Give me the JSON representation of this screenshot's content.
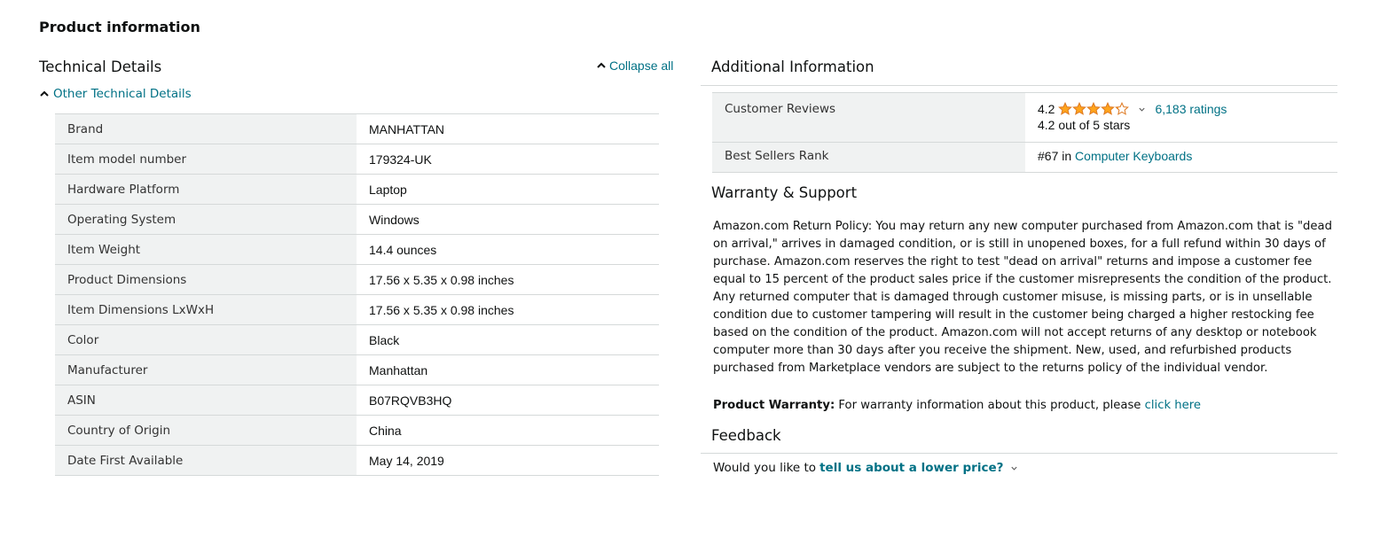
{
  "page_title": "Product information",
  "technical": {
    "heading": "Technical Details",
    "collapse_all": "Collapse all",
    "other_details": "Other Technical Details",
    "rows": [
      {
        "label": "Brand",
        "value": "MANHATTAN"
      },
      {
        "label": "Item model number",
        "value": "179324-UK"
      },
      {
        "label": "Hardware Platform",
        "value": "Laptop"
      },
      {
        "label": "Operating System",
        "value": "Windows"
      },
      {
        "label": "Item Weight",
        "value": "14.4 ounces"
      },
      {
        "label": "Product Dimensions",
        "value": "17.56 x 5.35 x 0.98 inches"
      },
      {
        "label": "Item Dimensions LxWxH",
        "value": "17.56 x 5.35 x 0.98 inches"
      },
      {
        "label": "Color",
        "value": "Black"
      },
      {
        "label": "Manufacturer",
        "value": "Manhattan"
      },
      {
        "label": "ASIN",
        "value": "B07RQVB3HQ"
      },
      {
        "label": "Country of Origin",
        "value": "China"
      },
      {
        "label": "Date First Available",
        "value": "May 14, 2019"
      }
    ]
  },
  "additional": {
    "heading": "Additional Information",
    "reviews_label": "Customer Reviews",
    "rating_value": "4.2",
    "rating_fraction": 0.84,
    "ratings_count": "6,183 ratings",
    "rating_text": "4.2 out of 5 stars",
    "rank_label": "Best Sellers Rank",
    "rank_value": "#67 in",
    "rank_category": "Computer Keyboards"
  },
  "warranty": {
    "heading": "Warranty & Support",
    "body": "Amazon.com Return Policy: You may return any new computer purchased from Amazon.com that is \"dead on arrival,\" arrives in damaged condition, or is still in unopened boxes, for a full refund within 30 days of purchase. Amazon.com reserves the right to test \"dead on arrival\" returns and impose a customer fee equal to 15 percent of the product sales price if the customer misrepresents the condition of the product. Any returned computer that is damaged through customer misuse, is missing parts, or is in unsellable condition due to customer tampering will result in the customer being charged a higher restocking fee based on the condition of the product. Amazon.com will not accept returns of any desktop or notebook computer more than 30 days after you receive the shipment. New, used, and refurbished products purchased from Marketplace vendors are subject to the returns policy of the individual vendor.",
    "product_warranty_label": "Product Warranty:",
    "product_warranty_text": "For warranty information about this product, please",
    "click_here": "click here"
  },
  "feedback": {
    "heading": "Feedback",
    "prompt": "Would you like to",
    "link": "tell us about a lower price?"
  },
  "colors": {
    "link": "#007185",
    "star": "#ffa41c",
    "table_header_bg": "#f0f2f2",
    "border": "#d5d9d9"
  }
}
